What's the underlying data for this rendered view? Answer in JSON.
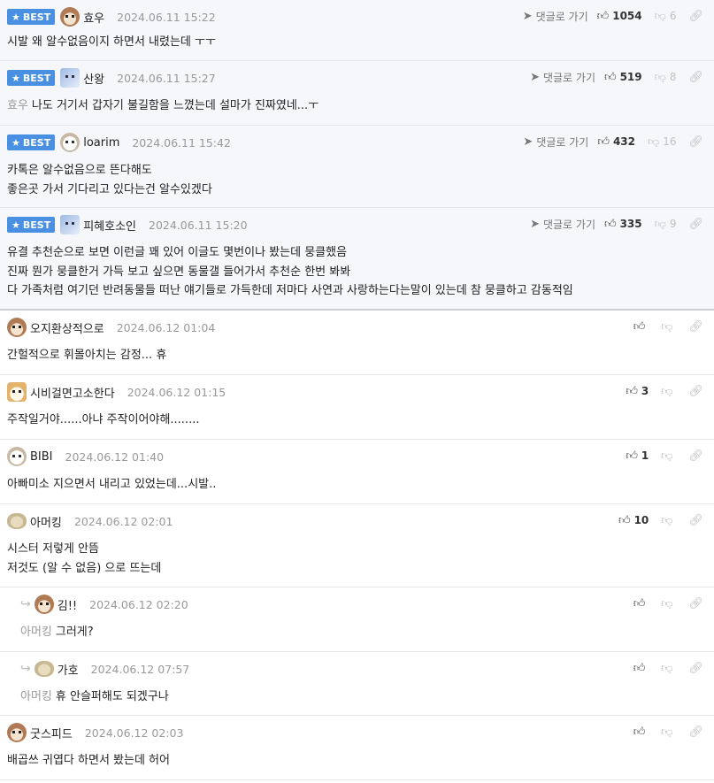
{
  "badge_label": "BEST",
  "reply_link_label": "댓글로 가기",
  "comments": [
    {
      "kind": "best",
      "avatar": "pup",
      "nick": "효우",
      "date": "2024.06.11 15:22",
      "likes": "1054",
      "dislikes": "6",
      "mention": "",
      "lines": [
        "시발 왜 알수없음이지 하면서 내렸는데 ㅜㅜ"
      ]
    },
    {
      "kind": "best",
      "avatar": "sq",
      "nick": "산왕",
      "date": "2024.06.11 15:27",
      "likes": "519",
      "dislikes": "8",
      "mention": "효우",
      "lines": [
        "나도 거기서 갑자기 불길함을 느꼈는데 설마가 진짜였네...ㅜ"
      ]
    },
    {
      "kind": "best",
      "avatar": "dog",
      "nick": "loarim",
      "date": "2024.06.11 15:42",
      "likes": "432",
      "dislikes": "16",
      "mention": "",
      "lines": [
        "카톡은 알수없음으로 뜬다해도",
        "좋은곳 가서 기다리고 있다는건 알수있겠다"
      ]
    },
    {
      "kind": "best",
      "avatar": "sq",
      "nick": "피혜호소인",
      "date": "2024.06.11 15:20",
      "likes": "335",
      "dislikes": "9",
      "mention": "",
      "lines": [
        "유결 추천순으로 보면 이런글 꽤 있어 이글도 몇번이나 봤는데 뭉클했음",
        "진짜 뭔가 뭉클한거 가득 보고 싶으면 동물갤 들어가서 추천순 한번 봐봐",
        "다 가족처럼 여기던 반려동물들 떠난 얘기들로 가득한데 저마다 사연과 사랑하는다는말이 있는데 참 뭉클하고 감동적임"
      ]
    },
    {
      "kind": "normal",
      "avatar": "pup",
      "nick": "오지환상적으로",
      "date": "2024.06.12 01:04",
      "likes": "",
      "dislikes": "",
      "mention": "",
      "lines": [
        "간헐적으로 휘몰아치는 감정... 휴"
      ]
    },
    {
      "kind": "normal",
      "avatar": "fox",
      "nick": "시비걸면고소한다",
      "date": "2024.06.12 01:15",
      "likes": "3",
      "dislikes": "",
      "mention": "",
      "lines": [
        "주작일거야......아냐 주작이어야해........"
      ]
    },
    {
      "kind": "normal",
      "avatar": "dog",
      "nick": "BIBI",
      "date": "2024.06.12 01:40",
      "likes": "1",
      "dislikes": "",
      "mention": "",
      "lines": [
        "아빠미소 지으면서 내리고 있었는데...시발.."
      ]
    },
    {
      "kind": "normal",
      "avatar": "bun",
      "nick": "아머킹",
      "date": "2024.06.12 02:01",
      "likes": "10",
      "dislikes": "",
      "mention": "",
      "lines": [
        "시스터 저렇게 안뜸",
        "저것도 (알 수 없음) 으로 뜨는데"
      ]
    },
    {
      "kind": "reply",
      "avatar": "pup",
      "nick": "김!!",
      "date": "2024.06.12 02:20",
      "likes": "",
      "dislikes": "",
      "mention": "아머킹",
      "lines": [
        "그러게?"
      ]
    },
    {
      "kind": "reply",
      "avatar": "bun",
      "nick": "가호",
      "date": "2024.06.12 07:57",
      "likes": "",
      "dislikes": "",
      "mention": "아머킹",
      "lines": [
        "휴 안슬퍼해도 되겠구나"
      ]
    },
    {
      "kind": "normal",
      "avatar": "pup",
      "nick": "굿스피드",
      "date": "2024.06.12 02:03",
      "likes": "",
      "dislikes": "",
      "mention": "",
      "lines": [
        "배곱쓰 귀엽다 하면서 봤는데 허어"
      ]
    }
  ]
}
